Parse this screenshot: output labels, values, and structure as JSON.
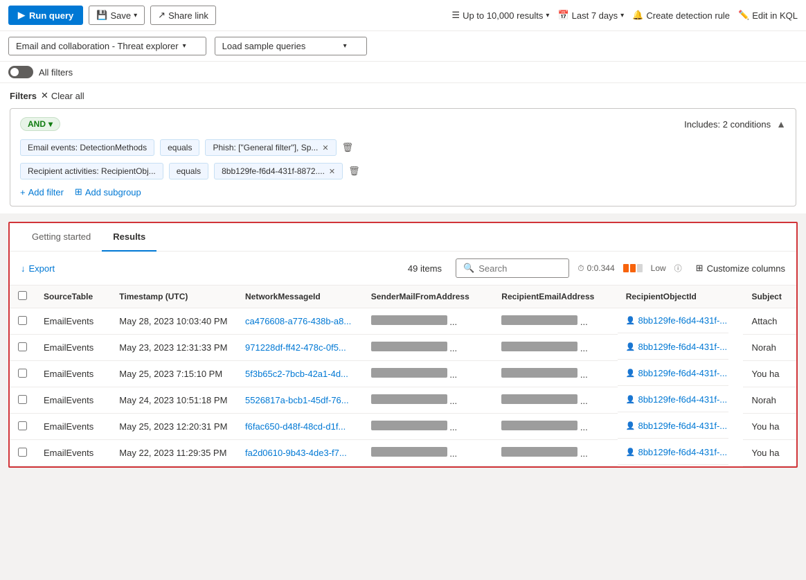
{
  "toolbar": {
    "run_query_label": "Run query",
    "save_label": "Save",
    "share_link_label": "Share link",
    "results_limit_label": "Up to 10,000 results",
    "date_range_label": "Last 7 days",
    "create_rule_label": "Create detection rule",
    "edit_kql_label": "Edit in KQL"
  },
  "filter_bar": {
    "source_dropdown_label": "Email and collaboration - Threat explorer",
    "sample_queries_label": "Load sample queries"
  },
  "toggle_row": {
    "all_filters_label": "All filters"
  },
  "filters": {
    "label": "Filters",
    "clear_all_label": "Clear all",
    "group": {
      "and_label": "AND",
      "includes_label": "Includes: 2 conditions",
      "row1": {
        "field": "Email events: DetectionMethods",
        "operator": "equals",
        "value": "Phish: [\"General filter\"], Sp...",
        "delete_title": "delete filter 1"
      },
      "row2": {
        "field": "Recipient activities: RecipientObj...",
        "operator": "equals",
        "value": "8bb129fe-f6d4-431f-8872....",
        "delete_title": "delete filter 2"
      },
      "add_filter_label": "Add filter",
      "add_subgroup_label": "Add subgroup"
    }
  },
  "tabs": {
    "getting_started": "Getting started",
    "results": "Results"
  },
  "results_toolbar": {
    "export_label": "Export",
    "items_count": "49",
    "items_label": "items",
    "search_placeholder": "Search",
    "time_label": "0:0.344",
    "perf_label": "Low",
    "customize_label": "Customize columns"
  },
  "table": {
    "headers": [
      "SourceTable",
      "Timestamp (UTC)",
      "NetworkMessageId",
      "SenderMailFromAddress",
      "RecipientEmailAddress",
      "RecipientObjectId",
      "Subject"
    ],
    "rows": [
      {
        "source": "EmailEvents",
        "timestamp": "May 28, 2023 10:03:40 PM",
        "network_id": "ca476608-a776-438b-a8...",
        "sender": "",
        "recipient": "",
        "recipient_obj": "8bb129fe-f6d4-431f-...",
        "subject": "Attach"
      },
      {
        "source": "EmailEvents",
        "timestamp": "May 23, 2023 12:31:33 PM",
        "network_id": "971228df-ff42-478c-0f5...",
        "sender": "",
        "recipient": "",
        "recipient_obj": "8bb129fe-f6d4-431f-...",
        "subject": "Norah"
      },
      {
        "source": "EmailEvents",
        "timestamp": "May 25, 2023 7:15:10 PM",
        "network_id": "5f3b65c2-7bcb-42a1-4d...",
        "sender": "",
        "recipient": "",
        "recipient_obj": "8bb129fe-f6d4-431f-...",
        "subject": "You ha"
      },
      {
        "source": "EmailEvents",
        "timestamp": "May 24, 2023 10:51:18 PM",
        "network_id": "5526817a-bcb1-45df-76...",
        "sender": "",
        "recipient": "",
        "recipient_obj": "8bb129fe-f6d4-431f-...",
        "subject": "Norah"
      },
      {
        "source": "EmailEvents",
        "timestamp": "May 25, 2023 12:20:31 PM",
        "network_id": "f6fac650-d48f-48cd-d1f...",
        "sender": "",
        "recipient": "",
        "recipient_obj": "8bb129fe-f6d4-431f-...",
        "subject": "You ha"
      },
      {
        "source": "EmailEvents",
        "timestamp": "May 22, 2023 11:29:35 PM",
        "network_id": "fa2d0610-9b43-4de3-f7...",
        "sender": "",
        "recipient": "",
        "recipient_obj": "8bb129fe-f6d4-431f-...",
        "subject": "You ha"
      }
    ]
  }
}
